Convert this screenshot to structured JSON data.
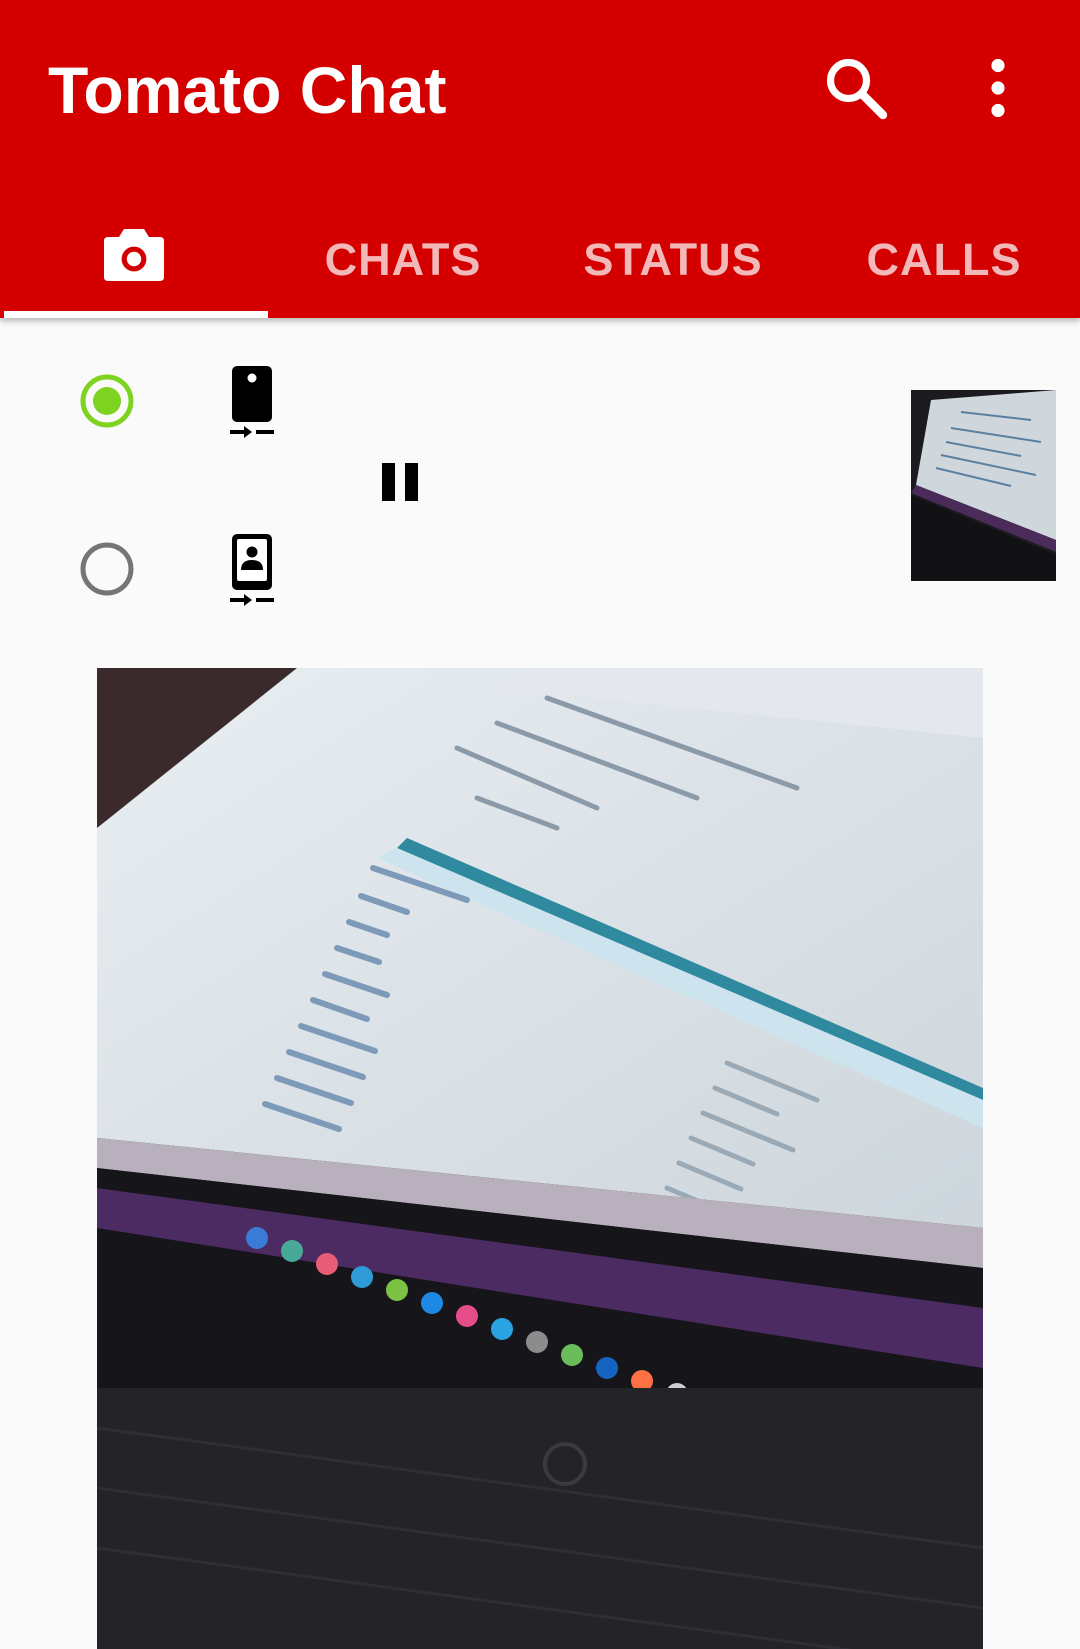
{
  "app": {
    "title": "Tomato Chat",
    "accent_color": "#D40000",
    "radio_selected_color": "#7ED321"
  },
  "toolbar": {
    "icons": [
      "search-icon",
      "more-vert-icon"
    ]
  },
  "tabs": {
    "camera": {
      "icon": "camera-icon"
    },
    "chats": {
      "label": "CHATS"
    },
    "status": {
      "label": "STATUS"
    },
    "calls": {
      "label": "CALLS"
    },
    "selected": "camera"
  },
  "camera_controls": {
    "back_camera_selected": true,
    "front_camera_selected": false,
    "back_camera_icon": "rear-camera-switch-icon",
    "front_camera_icon": "front-camera-switch-icon",
    "playback_icon": "pause-icon"
  }
}
